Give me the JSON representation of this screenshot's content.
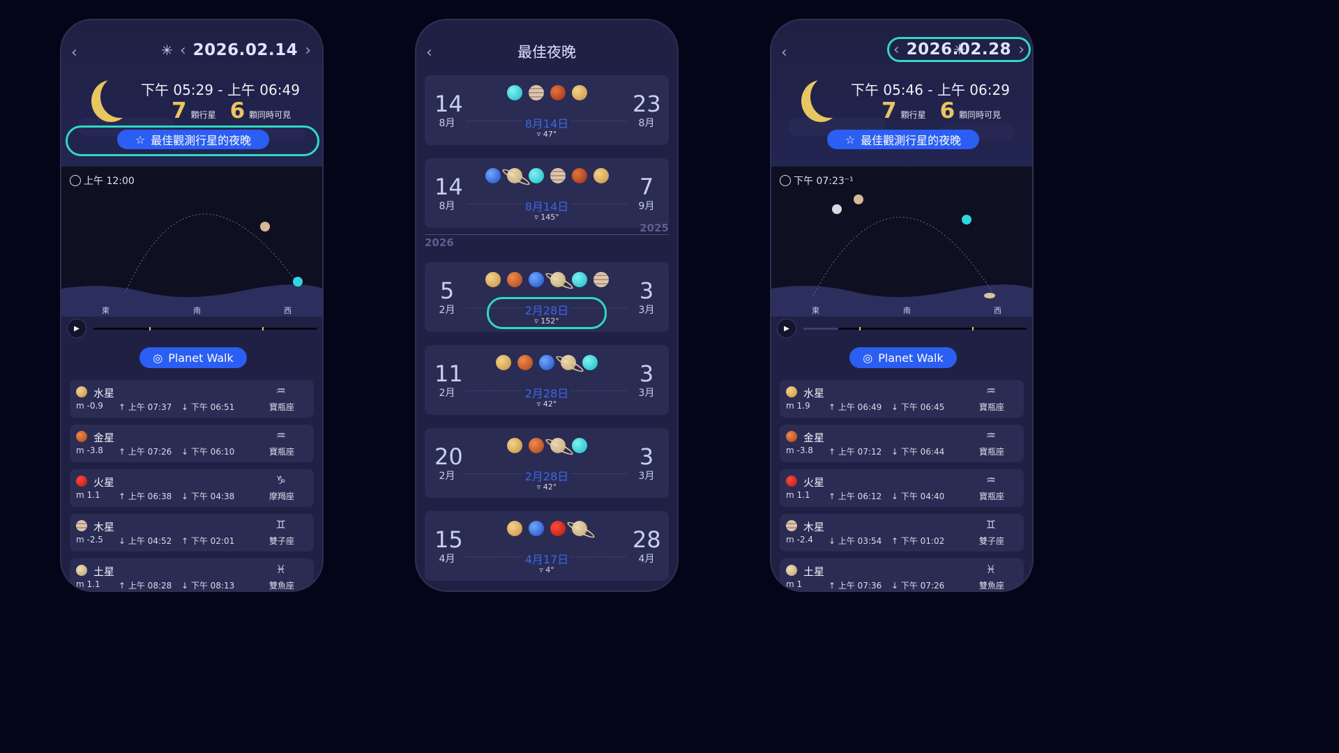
{
  "colors": {
    "accent": "#2b5ef2",
    "highlight": "#30d9c4",
    "gold": "#e8c660",
    "bg": "#050519",
    "panel": "#1f2043"
  },
  "phone1": {
    "date": "2026.02.14",
    "time_range": "下午 05:29 - 上午 06:49",
    "planets_count": "7",
    "planets_label": "顆行星",
    "visible_count": "6",
    "visible_label": "顆同時可見",
    "best_nights_label": "最佳觀測行星的夜晚",
    "clock_time": "上午 12:00",
    "directions": [
      "東",
      "南",
      "西"
    ],
    "planet_walk": "Planet Walk",
    "planets": [
      {
        "name": "水星",
        "mag": "m -0.9",
        "r1": "↑ 上午 07:37",
        "r2": "↓ 下午 06:51",
        "zodiac": "寶瓶座",
        "color": "merc"
      },
      {
        "name": "金星",
        "mag": "m -3.8",
        "r1": "↑ 上午 07:26",
        "r2": "↓ 下午 06:10",
        "zodiac": "寶瓶座",
        "color": "ven"
      },
      {
        "name": "火星",
        "mag": "m 1.1",
        "r1": "↑ 上午 06:38",
        "r2": "↓ 下午 04:38",
        "zodiac": "摩羯座",
        "color": "red"
      },
      {
        "name": "木星",
        "mag": "m -2.5",
        "r1": "↓ 上午 04:52",
        "r2": "↑ 下午 02:01",
        "zodiac": "雙子座",
        "color": "jup"
      },
      {
        "name": "土星",
        "mag": "m 1.1",
        "r1": "↑ 上午 08:28",
        "r2": "↓ 下午 08:13",
        "zodiac": "雙魚座",
        "color": "satb"
      }
    ]
  },
  "phone2": {
    "title": "最佳夜晚",
    "year_above": "2025",
    "year_below": "2026",
    "cards": [
      {
        "sd": "14",
        "sm": "8月",
        "ed": "23",
        "em": "8月",
        "peak": "8月14日",
        "deg": "▿ 47°",
        "dots": [
          "cyan",
          "jup",
          "mars",
          "merc"
        ]
      },
      {
        "sd": "14",
        "sm": "8月",
        "ed": "7",
        "em": "9月",
        "peak": "8月14日",
        "deg": "▿ 145°",
        "dots": [
          "nep",
          "satb",
          "cyan",
          "jup",
          "mars",
          "merc"
        ]
      },
      {
        "sd": "5",
        "sm": "2月",
        "ed": "3",
        "em": "3月",
        "peak": "2月28日",
        "deg": "▿ 152°",
        "dots": [
          "merc",
          "ven",
          "nep",
          "satb",
          "cyan",
          "jup"
        ]
      },
      {
        "sd": "11",
        "sm": "2月",
        "ed": "3",
        "em": "3月",
        "peak": "2月28日",
        "deg": "▿ 42°",
        "dots": [
          "merc",
          "ven",
          "nep",
          "satb",
          "cyan"
        ]
      },
      {
        "sd": "20",
        "sm": "2月",
        "ed": "3",
        "em": "3月",
        "peak": "2月28日",
        "deg": "▿ 42°",
        "dots": [
          "merc",
          "ven",
          "satb",
          "cyan"
        ]
      },
      {
        "sd": "15",
        "sm": "4月",
        "ed": "28",
        "em": "4月",
        "peak": "4月17日",
        "deg": "▿ 4°",
        "dots": [
          "merc",
          "nep",
          "red",
          "satb"
        ]
      }
    ]
  },
  "phone3": {
    "date": "2026.02.28",
    "time_range": "下午 05:46 - 上午 06:29",
    "planets_count": "7",
    "planets_label": "顆行星",
    "visible_count": "6",
    "visible_label": "顆同時可見",
    "best_nights_label": "最佳觀測行星的夜晚",
    "clock_time": "下午 07:23⁻¹",
    "directions": [
      "東",
      "南",
      "西"
    ],
    "planet_walk": "Planet Walk",
    "planets": [
      {
        "name": "水星",
        "mag": "m 1.9",
        "r1": "↑ 上午 06:49",
        "r2": "↓ 下午 06:45",
        "zodiac": "寶瓶座",
        "color": "merc"
      },
      {
        "name": "金星",
        "mag": "m -3.8",
        "r1": "↑ 上午 07:12",
        "r2": "↓ 下午 06:44",
        "zodiac": "寶瓶座",
        "color": "ven"
      },
      {
        "name": "火星",
        "mag": "m 1.1",
        "r1": "↑ 上午 06:12",
        "r2": "↓ 下午 04:40",
        "zodiac": "寶瓶座",
        "color": "red"
      },
      {
        "name": "木星",
        "mag": "m -2.4",
        "r1": "↓ 上午 03:54",
        "r2": "↑ 下午 01:02",
        "zodiac": "雙子座",
        "color": "jup"
      },
      {
        "name": "土星",
        "mag": "m 1",
        "r1": "↑ 上午 07:36",
        "r2": "↓ 下午 07:26",
        "zodiac": "雙魚座",
        "color": "satb"
      }
    ]
  }
}
